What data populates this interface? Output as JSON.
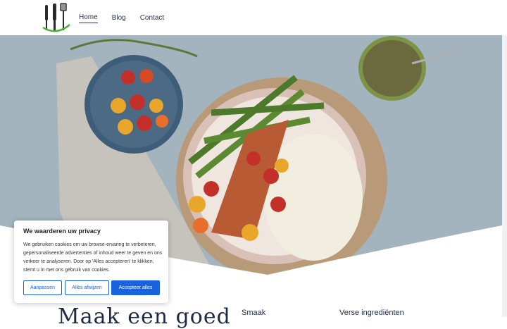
{
  "nav": {
    "items": [
      {
        "label": "Home",
        "active": true
      },
      {
        "label": "Blog",
        "active": false
      },
      {
        "label": "Contact",
        "active": false
      }
    ]
  },
  "hero": {
    "image": "food-bowl-photo",
    "colors": {
      "background": "#9fb0bb",
      "plate": "#d9c1b8",
      "napkin": "#c6c3bd"
    }
  },
  "section": {
    "title_partial": "Maak een goed",
    "feature_1": "Smaak",
    "feature_2": "Verse ingrediënten"
  },
  "cookie_banner": {
    "title": "We waarderen uw privacy",
    "text": "We gebruiken cookies om uw browse-ervaring te verbeteren, gepersonaliseerde advertenties of inhoud weer te geven en ons verkeer te analyseren. Door op 'Alles accepteren' te klikken, stemt u in met ons gebruik van cookies.",
    "buttons": {
      "customize": "Aanpassen",
      "reject": "Alles afwijzen",
      "accept": "Accepteer alles"
    },
    "accent_color": "#1863dc"
  }
}
